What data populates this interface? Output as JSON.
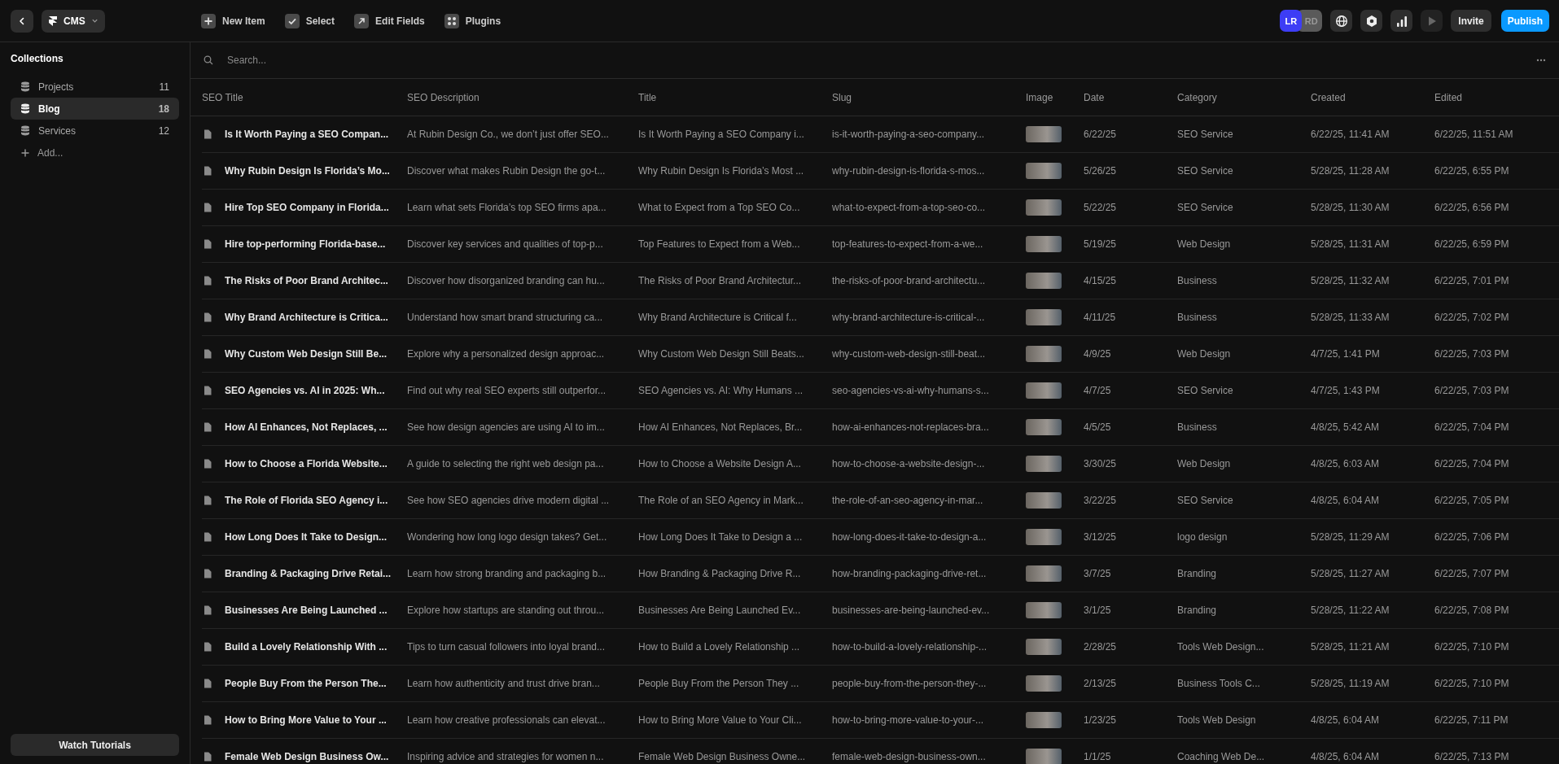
{
  "top_bar": {
    "app_menu": "CMS",
    "actions": [
      "New Item",
      "Select",
      "Edit Fields",
      "Plugins"
    ],
    "avatars": [
      {
        "initials": "LR",
        "color": "#3d3df5"
      },
      {
        "initials": "RD",
        "color": "#5a5a5a"
      }
    ],
    "preview_disabled": true,
    "invite": "Invite",
    "publish": "Publish"
  },
  "sidebar": {
    "heading": "Collections",
    "items": [
      {
        "label": "Projects",
        "count": "11",
        "selected": false
      },
      {
        "label": "Blog",
        "count": "18",
        "selected": true
      },
      {
        "label": "Services",
        "count": "12",
        "selected": false
      }
    ],
    "add": "Add...",
    "tutorials": "Watch Tutorials"
  },
  "search": {
    "placeholder": "Search..."
  },
  "table": {
    "columns": [
      "SEO Title",
      "SEO Description",
      "Title",
      "Slug",
      "Image",
      "Date",
      "Category",
      "Created",
      "Edited"
    ],
    "rows": [
      {
        "seo_title": "Is It Worth Paying a SEO Compan...",
        "seo_description": "At Rubin Design Co., we don’t just offer SEO...",
        "title": "Is It Worth Paying a SEO Company i...",
        "slug": "is-it-worth-paying-a-seo-company...",
        "date": "6/22/25",
        "category": "SEO Service",
        "created": "6/22/25, 11:41 AM",
        "edited": "6/22/25, 11:51 AM"
      },
      {
        "seo_title": "Why Rubin Design Is Florida’s Mo...",
        "seo_description": "Discover what makes Rubin Design the go-t...",
        "title": "Why Rubin Design Is Florida’s Most ...",
        "slug": "why-rubin-design-is-florida-s-mos...",
        "date": "5/26/25",
        "category": "SEO Service",
        "created": "5/28/25, 11:28 AM",
        "edited": "6/22/25, 6:55 PM"
      },
      {
        "seo_title": "Hire Top SEO Company in Florida...",
        "seo_description": "Learn what sets Florida’s top SEO firms apa...",
        "title": "What to Expect from a Top SEO Co...",
        "slug": "what-to-expect-from-a-top-seo-co...",
        "date": "5/22/25",
        "category": "SEO Service",
        "created": "5/28/25, 11:30 AM",
        "edited": "6/22/25, 6:56 PM"
      },
      {
        "seo_title": "Hire top-performing Florida-base...",
        "seo_description": "Discover key services and qualities of top-p...",
        "title": "Top Features to Expect from a Web...",
        "slug": "top-features-to-expect-from-a-we...",
        "date": "5/19/25",
        "category": "Web Design",
        "created": "5/28/25, 11:31 AM",
        "edited": "6/22/25, 6:59 PM"
      },
      {
        "seo_title": "The Risks of Poor Brand Architec...",
        "seo_description": "Discover how disorganized branding can hu...",
        "title": "The Risks of Poor Brand Architectur...",
        "slug": "the-risks-of-poor-brand-architectu...",
        "date": "4/15/25",
        "category": "Business",
        "created": "5/28/25, 11:32 AM",
        "edited": "6/22/25, 7:01 PM"
      },
      {
        "seo_title": "Why Brand Architecture is Critica...",
        "seo_description": "Understand how smart brand structuring ca...",
        "title": "Why Brand Architecture is Critical f...",
        "slug": "why-brand-architecture-is-critical-...",
        "date": "4/11/25",
        "category": "Business",
        "created": "5/28/25, 11:33 AM",
        "edited": "6/22/25, 7:02 PM"
      },
      {
        "seo_title": "Why Custom Web Design Still Be...",
        "seo_description": "Explore why a personalized design approac...",
        "title": "Why Custom Web Design Still Beats...",
        "slug": "why-custom-web-design-still-beat...",
        "date": "4/9/25",
        "category": "Web Design",
        "created": "4/7/25, 1:41 PM",
        "edited": "6/22/25, 7:03 PM"
      },
      {
        "seo_title": "SEO Agencies vs. AI in 2025: Wh...",
        "seo_description": "Find out why real SEO experts still outperfor...",
        "title": "SEO Agencies vs. AI: Why Humans ...",
        "slug": "seo-agencies-vs-ai-why-humans-s...",
        "date": "4/7/25",
        "category": "SEO Service",
        "created": "4/7/25, 1:43 PM",
        "edited": "6/22/25, 7:03 PM"
      },
      {
        "seo_title": "How AI Enhances, Not Replaces, ...",
        "seo_description": "See how design agencies are using AI to im...",
        "title": "How AI Enhances, Not Replaces, Br...",
        "slug": "how-ai-enhances-not-replaces-bra...",
        "date": "4/5/25",
        "category": "Business",
        "created": "4/8/25, 5:42 AM",
        "edited": "6/22/25, 7:04 PM"
      },
      {
        "seo_title": "How to Choose a Florida Website...",
        "seo_description": "A guide to selecting the right web design pa...",
        "title": "How to Choose a Website Design A...",
        "slug": "how-to-choose-a-website-design-...",
        "date": "3/30/25",
        "category": "Web Design",
        "created": "4/8/25, 6:03 AM",
        "edited": "6/22/25, 7:04 PM"
      },
      {
        "seo_title": "The Role of Florida SEO Agency i...",
        "seo_description": "See how SEO agencies drive modern digital ...",
        "title": "The Role of an SEO Agency in Mark...",
        "slug": "the-role-of-an-seo-agency-in-mar...",
        "date": "3/22/25",
        "category": "SEO Service",
        "created": "4/8/25, 6:04 AM",
        "edited": "6/22/25, 7:05 PM"
      },
      {
        "seo_title": "How Long Does It Take to Design...",
        "seo_description": "Wondering how long logo design takes? Get...",
        "title": "How Long Does It Take to Design a ...",
        "slug": "how-long-does-it-take-to-design-a...",
        "date": "3/12/25",
        "category": "logo design",
        "created": "5/28/25, 11:29 AM",
        "edited": "6/22/25, 7:06 PM"
      },
      {
        "seo_title": "Branding & Packaging Drive Retai...",
        "seo_description": "Learn how strong branding and packaging b...",
        "title": "How Branding & Packaging Drive R...",
        "slug": "how-branding-packaging-drive-ret...",
        "date": "3/7/25",
        "category": "Branding",
        "created": "5/28/25, 11:27 AM",
        "edited": "6/22/25, 7:07 PM"
      },
      {
        "seo_title": "Businesses Are Being Launched ...",
        "seo_description": "Explore how startups are standing out throu...",
        "title": "Businesses Are Being Launched Ev...",
        "slug": "businesses-are-being-launched-ev...",
        "date": "3/1/25",
        "category": "Branding",
        "created": "5/28/25, 11:22 AM",
        "edited": "6/22/25, 7:08 PM"
      },
      {
        "seo_title": "Build a Lovely Relationship With ...",
        "seo_description": "Tips to turn casual followers into loyal brand...",
        "title": "How to Build a Lovely Relationship ...",
        "slug": "how-to-build-a-lovely-relationship-...",
        "date": "2/28/25",
        "category": "Tools Web Design...",
        "created": "5/28/25, 11:21 AM",
        "edited": "6/22/25, 7:10 PM"
      },
      {
        "seo_title": "People Buy From the Person The...",
        "seo_description": "Learn how authenticity and trust drive bran...",
        "title": "People Buy From the Person They ...",
        "slug": "people-buy-from-the-person-they-...",
        "date": "2/13/25",
        "category": "Business Tools C...",
        "created": "5/28/25, 11:19 AM",
        "edited": "6/22/25, 7:10 PM"
      },
      {
        "seo_title": "How to Bring More Value to Your ...",
        "seo_description": "Learn how creative professionals can elevat...",
        "title": "How to Bring More Value to Your Cli...",
        "slug": "how-to-bring-more-value-to-your-...",
        "date": "1/23/25",
        "category": "Tools Web Design",
        "created": "4/8/25, 6:04 AM",
        "edited": "6/22/25, 7:11 PM"
      },
      {
        "seo_title": "Female Web Design Business Ow...",
        "seo_description": "Inspiring advice and strategies for women n...",
        "title": "Female Web Design Business Owne...",
        "slug": "female-web-design-business-own...",
        "date": "1/1/25",
        "category": "Coaching Web De...",
        "created": "4/8/25, 6:04 AM",
        "edited": "6/22/25, 7:13 PM"
      }
    ]
  }
}
